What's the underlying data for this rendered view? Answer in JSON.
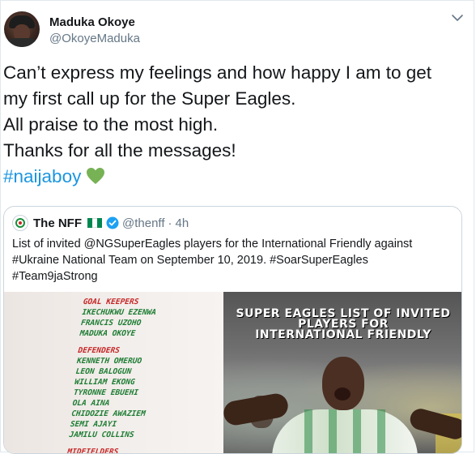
{
  "author": {
    "name": "Maduka Okoye",
    "handle": "@OkoyeMaduka"
  },
  "icons": {
    "menu": "chevron-down-icon",
    "heart": "green-heart-icon",
    "verified": "verified-badge-icon",
    "flag": "nigeria-flag-icon"
  },
  "tweet": {
    "lines": [
      "Can’t express my feelings and how happy I am to get",
      "my first call up for the Super Eagles.",
      "All praise to the most high.",
      "Thanks for all the messages!"
    ],
    "hashtag": "#naijaboy"
  },
  "quoted": {
    "name": "The NFF",
    "handle": "@thenff",
    "separator": "·",
    "time": "4h",
    "lines": [
      "List of invited @NGSuperEagles players for the International Friendly against",
      "#Ukraine National Team on September 10, 2019. #SoarSuperEagles",
      "#Team9jaStrong"
    ],
    "media": {
      "sections": [
        {
          "title": "GOAL KEEPERS",
          "players": [
            "IKECHUKWU EZENWA",
            "FRANCIS UZOHO",
            "MADUKA OKOYE"
          ]
        },
        {
          "title": "DEFENDERS",
          "players": [
            "KENNETH OMERUO",
            "LEON BALOGUN",
            "WILLIAM EKONG",
            "TYRONNE EBUEHI",
            "OLA AINA",
            "CHIDOZIE AWAZIEM",
            "SEMI AJAYI",
            "JAMILU COLLINS"
          ]
        },
        {
          "title": "MIDFIELDERS",
          "players": []
        }
      ],
      "title_lines": [
        "SUPER EAGLES LIST OF INVITED",
        "PLAYERS FOR",
        "INTERNATIONAL FRIENDLY"
      ]
    }
  },
  "colors": {
    "hashtag": "#1b95e0",
    "heart": "#77b255",
    "verified": "#1da1f2",
    "flag_green": "#008751",
    "section_red": "#c62828",
    "player_green": "#1e7d34"
  }
}
